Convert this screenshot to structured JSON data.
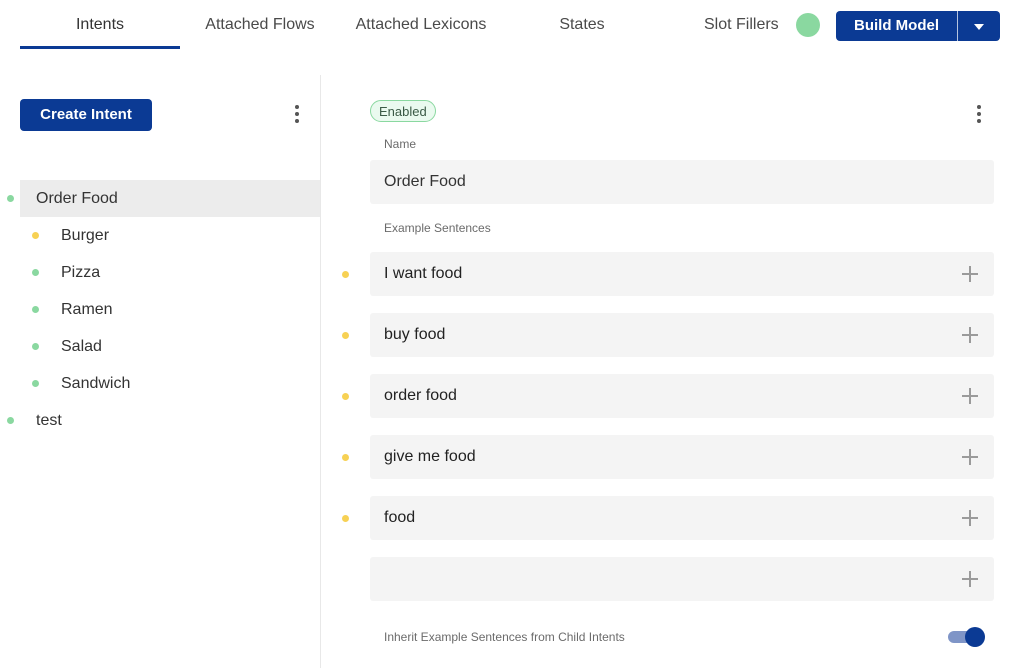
{
  "tabs": [
    {
      "label": "Intents",
      "active": true
    },
    {
      "label": "Attached Flows",
      "active": false
    },
    {
      "label": "Attached Lexicons",
      "active": false
    },
    {
      "label": "States",
      "active": false
    }
  ],
  "header": {
    "slot_fillers_label": "Slot Fillers",
    "status_color": "#8ad8a0",
    "build_model_label": "Build Model",
    "build_dropdown_icon": "caret-down-icon"
  },
  "sidebar": {
    "create_intent_label": "Create Intent",
    "menu_icon": "more-vertical-icon",
    "intents": [
      {
        "label": "Order Food",
        "status": "green",
        "level": 0,
        "selected": true
      },
      {
        "label": "Burger",
        "status": "yellow",
        "level": 1,
        "selected": false
      },
      {
        "label": "Pizza",
        "status": "green",
        "level": 1,
        "selected": false
      },
      {
        "label": "Ramen",
        "status": "green",
        "level": 1,
        "selected": false
      },
      {
        "label": "Salad",
        "status": "green",
        "level": 1,
        "selected": false
      },
      {
        "label": "Sandwich",
        "status": "green",
        "level": 1,
        "selected": false
      },
      {
        "label": "test",
        "status": "green",
        "level": 0,
        "selected": false
      }
    ]
  },
  "detail": {
    "status_badge": "Enabled",
    "menu_icon": "more-vertical-icon",
    "name_label": "Name",
    "name_value": "Order Food",
    "examples_label": "Example Sentences",
    "examples": [
      {
        "text": "I want food",
        "status": "yellow"
      },
      {
        "text": "buy food",
        "status": "yellow"
      },
      {
        "text": "order food",
        "status": "yellow"
      },
      {
        "text": "give me food",
        "status": "yellow"
      },
      {
        "text": "food",
        "status": "yellow"
      },
      {
        "text": "",
        "status": "none"
      }
    ],
    "inherit_label": "Inherit Example Sentences from Child Intents",
    "inherit_enabled": true
  },
  "colors": {
    "primary": "#0b3a94",
    "status_green": "#8ad8a0",
    "status_yellow": "#f7d154"
  }
}
